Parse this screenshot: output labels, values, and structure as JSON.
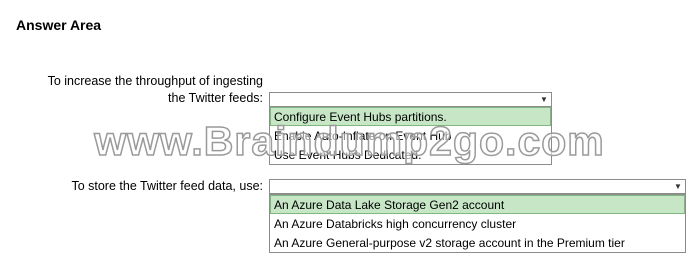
{
  "title": "Answer Area",
  "question1": {
    "label_line1": "To increase the throughput of ingesting",
    "label_line2": "the Twitter feeds:",
    "options": [
      "Configure Event Hubs partitions.",
      "Enable Auto-Inflate on Event Hub",
      "Use Event Hubs Dedicated."
    ],
    "selected_index": 0
  },
  "question2": {
    "label": "To store the Twitter feed data, use:",
    "options": [
      "An Azure Data Lake Storage Gen2 account",
      "An Azure Databricks high concurrency cluster",
      "An Azure General-purpose v2 storage account in the Premium tier"
    ],
    "selected_index": 0
  },
  "watermark": "www.Braindump2go.com",
  "icons": {
    "dropdown_arrow": "▼"
  }
}
